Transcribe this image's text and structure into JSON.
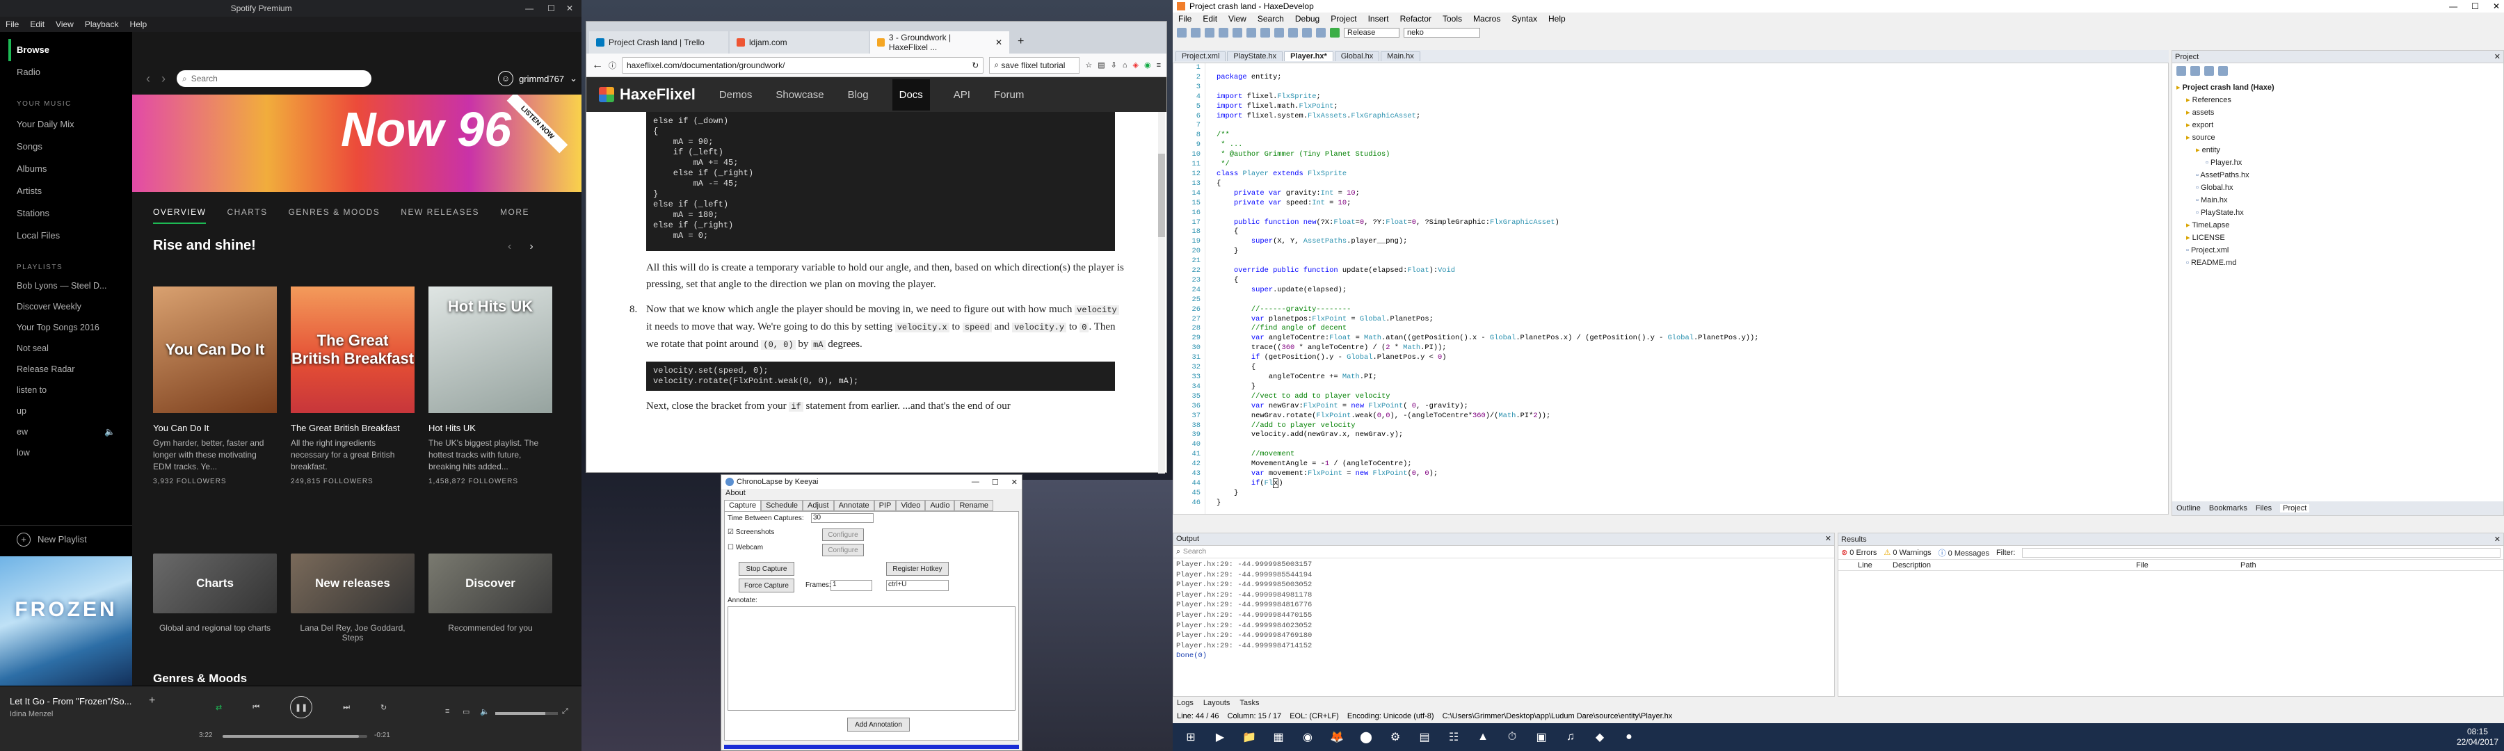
{
  "spotify": {
    "title": "Spotify Premium",
    "menu": [
      "File",
      "Edit",
      "View",
      "Playback",
      "Help"
    ],
    "nav": [
      "Browse",
      "Radio"
    ],
    "your_music_heading": "YOUR MUSIC",
    "your_music": [
      "Your Daily Mix",
      "Songs",
      "Albums",
      "Artists",
      "Stations",
      "Local Files"
    ],
    "playlists_heading": "PLAYLISTS",
    "playlists": [
      "Bob Lyons — Steel D...",
      "Discover Weekly",
      "Your Top Songs 2016",
      "Not seal",
      "Release Radar",
      "listen to",
      "up",
      "ew",
      "low"
    ],
    "new_playlist": "New Playlist",
    "search_placeholder": "Search",
    "username": "grimmd767",
    "banner_text": "Now 96",
    "banner_badge": "LISTEN NOW",
    "tabs": [
      "OVERVIEW",
      "CHARTS",
      "GENRES & MOODS",
      "NEW RELEASES",
      "MORE"
    ],
    "section_title": "Rise and shine!",
    "cards": [
      {
        "cover": "You Can Do It",
        "title": "You Can Do It",
        "desc": "Gym harder, better, faster and longer with these motivating EDM tracks. Ye...",
        "followers": "3,932 FOLLOWERS",
        "bg": "#c06a2e"
      },
      {
        "cover": "The Great British Breakfast",
        "title": "The Great British Breakfast",
        "desc": "All the right ingredients necessary for a great British breakfast.",
        "followers": "249,815 FOLLOWERS",
        "bg": "#e7603b"
      },
      {
        "cover": "Hot Hits UK",
        "title": "Hot Hits UK",
        "desc": "The UK's biggest playlist. The hottest tracks with future, breaking hits added...",
        "followers": "1,458,872 FOLLOWERS",
        "bg": "#7a8b8a"
      }
    ],
    "genre_cards": [
      {
        "label": "Charts",
        "sub": "Global and regional top charts",
        "bg": "#4b4b4b"
      },
      {
        "label": "New releases",
        "sub": "Lana Del Rey, Joe Goddard, Steps",
        "bg": "#555"
      },
      {
        "label": "Discover",
        "sub": "Recommended for you",
        "bg": "#5a5a5a"
      }
    ],
    "genres_heading": "Genres & Moods",
    "now_playing": {
      "track": "Let It Go - From \"Frozen\"/So...",
      "artist": "Idina Menzel",
      "elapsed": "3:22",
      "remaining": "-0:21",
      "progress": 0.94
    },
    "album_art": "FROZEN"
  },
  "browser": {
    "tabs": [
      {
        "label": "Project Crash land | Trello",
        "color": "#0079bf"
      },
      {
        "label": "ldjam.com",
        "color": "#ee5533"
      },
      {
        "label": "3 - Groundwork | HaxeFlixel ...",
        "color": "#f5a623"
      }
    ],
    "url": "haxeflixel.com/documentation/groundwork/",
    "search_value": "save flixel tutorial",
    "site_logo": "HaxeFlixel",
    "site_nav": [
      "Demos",
      "Showcase",
      "Blog",
      "Docs",
      "API",
      "Forum"
    ],
    "site_nav_active": "Docs",
    "code1": [
      "else if (_down)",
      "{",
      "    mA = 90;",
      "    if (_left)",
      "        mA += 45;",
      "    else if (_right)",
      "        mA -= 45;",
      "}",
      "else if (_left)",
      "    mA = 180;",
      "else if (_right)",
      "    mA = 0;"
    ],
    "para1": "All this will do is create a temporary variable to hold our angle, and then, based on which direction(s) the player is pressing, set that angle to the direction we plan on moving the player.",
    "step_no": "8.",
    "para2_a": "Now that we know which angle the player should be moving in, we need to figure out with how much ",
    "para2_code1": "velocity",
    "para2_b": " it needs to move that way. We're going to do this by setting ",
    "para2_code2": "velocity.x",
    "para2_c": " to ",
    "para2_code3": "speed",
    "para2_d": " and ",
    "para2_code4": "velocity.y",
    "para2_e": " to ",
    "para2_code5": "0",
    "para2_f": ". Then we rotate that point around ",
    "para2_code6": "(0, 0)",
    "para2_g": " by ",
    "para2_code7": "mA",
    "para2_h": " degrees.",
    "code2": [
      "velocity.set(speed, 0);",
      "velocity.rotate(FlxPoint.weak(0, 0), mA);"
    ],
    "para3_a": "Next, close the bracket from your ",
    "para3_code": "if",
    "para3_b": " statement from earlier. ...and that's the end of our"
  },
  "chronolapse": {
    "title": "ChronoLapse by Keeyai",
    "menu": "About",
    "tabs": [
      "Capture",
      "Schedule",
      "Adjust",
      "Annotate",
      "PIP",
      "Video",
      "Audio",
      "Rename"
    ],
    "time_between": "Time Between Captures:",
    "time_value": "30",
    "screenshots": "Screenshots",
    "webcam": "Webcam",
    "configure": "Configure",
    "stop": "Stop Capture",
    "force": "Force Capture",
    "register": "Register Hotkey",
    "frames_label": "Frames:",
    "frames_value": "1",
    "hotkey": "ctrl+U",
    "annotate": "Annotate:",
    "add_annotation": "Add Annotation"
  },
  "haxedevelop": {
    "title": "Project crash land - HaxeDevelop",
    "menu": [
      "File",
      "Edit",
      "View",
      "Search",
      "Debug",
      "Project",
      "Insert",
      "Refactor",
      "Tools",
      "Macros",
      "Syntax",
      "Help"
    ],
    "build_config": "Release",
    "target": "neko",
    "doc_tabs": [
      "Project.xml",
      "PlayState.hx",
      "Player.hx*",
      "Global.hx",
      "Main.hx"
    ],
    "active_tab": "Player.hx*",
    "line_numbers": [
      "1",
      "2",
      "3",
      "4",
      "5",
      "6",
      "7",
      "8",
      "9",
      "10",
      "11",
      "12",
      "13",
      "14",
      "15",
      "16",
      "17",
      "18",
      "19",
      "20",
      "21",
      "22",
      "23",
      "24",
      "25",
      "26",
      "27",
      "28",
      "29",
      "30",
      "31",
      "32",
      "33",
      "34",
      "35",
      "36",
      "37",
      "38",
      "39",
      "40",
      "41",
      "42",
      "43",
      "44",
      "45",
      "46"
    ],
    "project_panel": "Project",
    "project_tree": [
      {
        "label": "Project crash land (Haxe)",
        "depth": 0
      },
      {
        "label": "References",
        "depth": 1
      },
      {
        "label": "assets",
        "depth": 1
      },
      {
        "label": "export",
        "depth": 1
      },
      {
        "label": "source",
        "depth": 1
      },
      {
        "label": "entity",
        "depth": 2
      },
      {
        "label": "Player.hx",
        "depth": 3
      },
      {
        "label": "AssetPaths.hx",
        "depth": 2
      },
      {
        "label": "Global.hx",
        "depth": 2
      },
      {
        "label": "Main.hx",
        "depth": 2
      },
      {
        "label": "PlayState.hx",
        "depth": 2
      },
      {
        "label": "TimeLapse",
        "depth": 1
      },
      {
        "label": "LICENSE",
        "depth": 1
      },
      {
        "label": "Project.xml",
        "depth": 1
      },
      {
        "label": "README.md",
        "depth": 1
      }
    ],
    "side_tabs": [
      "Outline",
      "Bookmarks",
      "Files",
      "Project"
    ],
    "output_title": "Output",
    "output_search": "Search",
    "output_lines": [
      "Player.hx:29: -44.9999985003157",
      "Player.hx:29: -44.9999985544194",
      "Player.hx:29: -44.9999985003052",
      "Player.hx:29: -44.9999984981178",
      "Player.hx:29: -44.9999984816776",
      "Player.hx:29: -44.9999984470155",
      "Player.hx:29: -44.9999984023052",
      "Player.hx:29: -44.9999984769180",
      "Player.hx:29: -44.9999984714152",
      "Done(0)"
    ],
    "results_title": "Results",
    "errors": "0 Errors",
    "warnings": "0 Warnings",
    "messages": "0 Messages",
    "filter": "Filter:",
    "result_cols": [
      "Line",
      "Description",
      "File",
      "Path"
    ],
    "bottom_tabs": [
      "Logs",
      "Layouts",
      "Tasks"
    ],
    "status": [
      "Line: 44 / 46",
      "Column: 15 / 17",
      "EOL: (CR+LF)",
      "Encoding: Unicode (utf-8)",
      "C:\\Users\\Grimmer\\Desktop\\app\\Ludum Dare\\source\\entity\\Player.hx"
    ]
  },
  "taskbar": {
    "time": "08:15",
    "date": "22/04/2017",
    "apps": [
      "⊞",
      "▶",
      "📁",
      "▦",
      "◉",
      "🦊",
      "⬤",
      "⚙",
      "▤",
      "☷",
      "▲",
      "⏱",
      "▣",
      "♫",
      "◆",
      "●"
    ]
  }
}
